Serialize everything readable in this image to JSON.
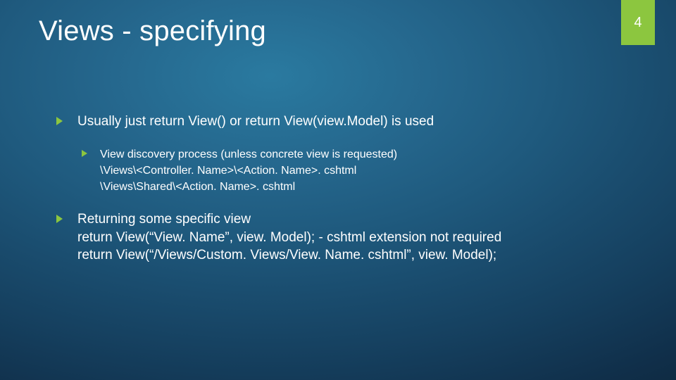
{
  "title": "Views - specifying",
  "page_number": "4",
  "accent_color": "#8cc63f",
  "bullets": [
    {
      "text": "Usually just return View() or return View(view.Model) is used",
      "children": [
        {
          "lines": [
            "View discovery process (unless concrete view is requested)",
            "\\Views\\<Controller. Name>\\<Action. Name>. cshtml",
            "\\Views\\Shared\\<Action. Name>. cshtml"
          ]
        }
      ]
    },
    {
      "lines": [
        "Returning some specific view",
        "return View(“View. Name”, view. Model); - cshtml extension not required",
        "return View(“/Views/Custom. Views/View. Name. cshtml”, view. Model);"
      ]
    }
  ]
}
